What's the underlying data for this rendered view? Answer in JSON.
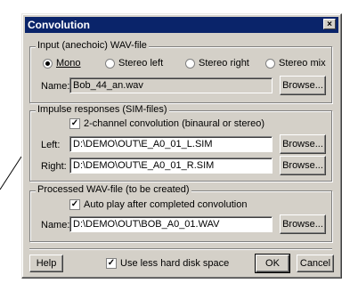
{
  "window": {
    "title": "Convolution",
    "close_glyph": "×"
  },
  "input_group": {
    "legend": "Input (anechoic) WAV-file",
    "options": [
      {
        "label": "Mono",
        "selected": true
      },
      {
        "label": "Stereo left",
        "selected": false
      },
      {
        "label": "Stereo right",
        "selected": false
      },
      {
        "label": "Stereo mix",
        "selected": false
      }
    ],
    "name_label": "Name:",
    "name_value": "Bob_44_an.wav",
    "browse_label": "Browse..."
  },
  "impulse_group": {
    "legend": "Impulse responses (SIM-files)",
    "two_channel_label": "2-channel convolution (binaural or stereo)",
    "two_channel_checked": true,
    "left_label": "Left:",
    "left_value": "D:\\DEMO\\OUT\\E_A0_01_L.SIM",
    "right_label": "Right:",
    "right_value": "D:\\DEMO\\OUT\\E_A0_01_R.SIM",
    "browse_left_label": "Browse...",
    "browse_right_label": "Browse..."
  },
  "output_group": {
    "legend": "Processed WAV-file (to be created)",
    "autoplay_label": "Auto play after completed convolution",
    "autoplay_checked": true,
    "name_label": "Name:",
    "name_value": "D:\\DEMO\\OUT\\BOB_A0_01.WAV",
    "browse_label": "Browse..."
  },
  "footer": {
    "help_label": "Help",
    "less_disk_label": "Use less hard disk space",
    "less_disk_checked": true,
    "ok_label": "OK",
    "cancel_label": "Cancel"
  }
}
